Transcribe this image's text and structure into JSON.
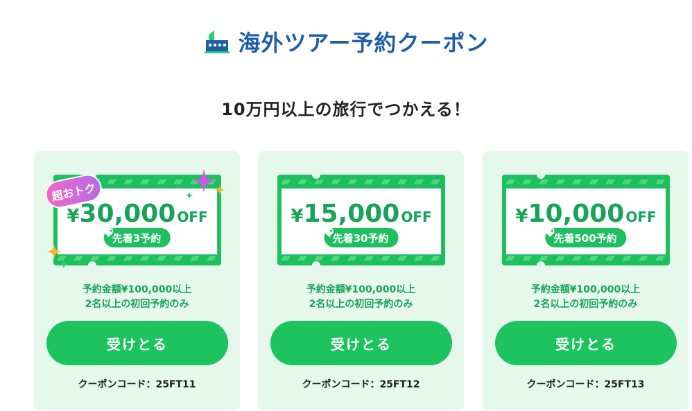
{
  "header": {
    "title": "海外ツアー予約クーポン",
    "logo_icon": "building-icon"
  },
  "subtitle": "10万円以上の旅行でつかえる！",
  "colors": {
    "brand_blue": "#1d5ea8",
    "green": "#1dc35f",
    "card_bg": "#e6f7ec",
    "badge_pink": "#f066c5"
  },
  "cards": [
    {
      "badge": "超おトク",
      "amount_yen": "¥",
      "amount": "30,000",
      "amount_suffix": "OFF",
      "pill_icon": "tag-icon",
      "pill": "先着3予約",
      "cond_line1": "予約金額¥100,000以上",
      "cond_line2": "2名以上の初回予約のみ",
      "button": "受けとる",
      "code": "クーポンコード：25FT11"
    },
    {
      "amount_yen": "¥",
      "amount": "15,000",
      "amount_suffix": "OFF",
      "pill_icon": "tag-icon",
      "pill": "先着30予約",
      "cond_line1": "予約金額¥100,000以上",
      "cond_line2": "2名以上の初回予約のみ",
      "button": "受けとる",
      "code": "クーポンコード：25FT12"
    },
    {
      "amount_yen": "¥",
      "amount": "10,000",
      "amount_suffix": "OFF",
      "pill_icon": "tag-icon",
      "pill": "先着500予約",
      "cond_line1": "予約金額¥100,000以上",
      "cond_line2": "2名以上の初回予約のみ",
      "button": "受けとる",
      "code": "クーポンコード：25FT13"
    }
  ]
}
